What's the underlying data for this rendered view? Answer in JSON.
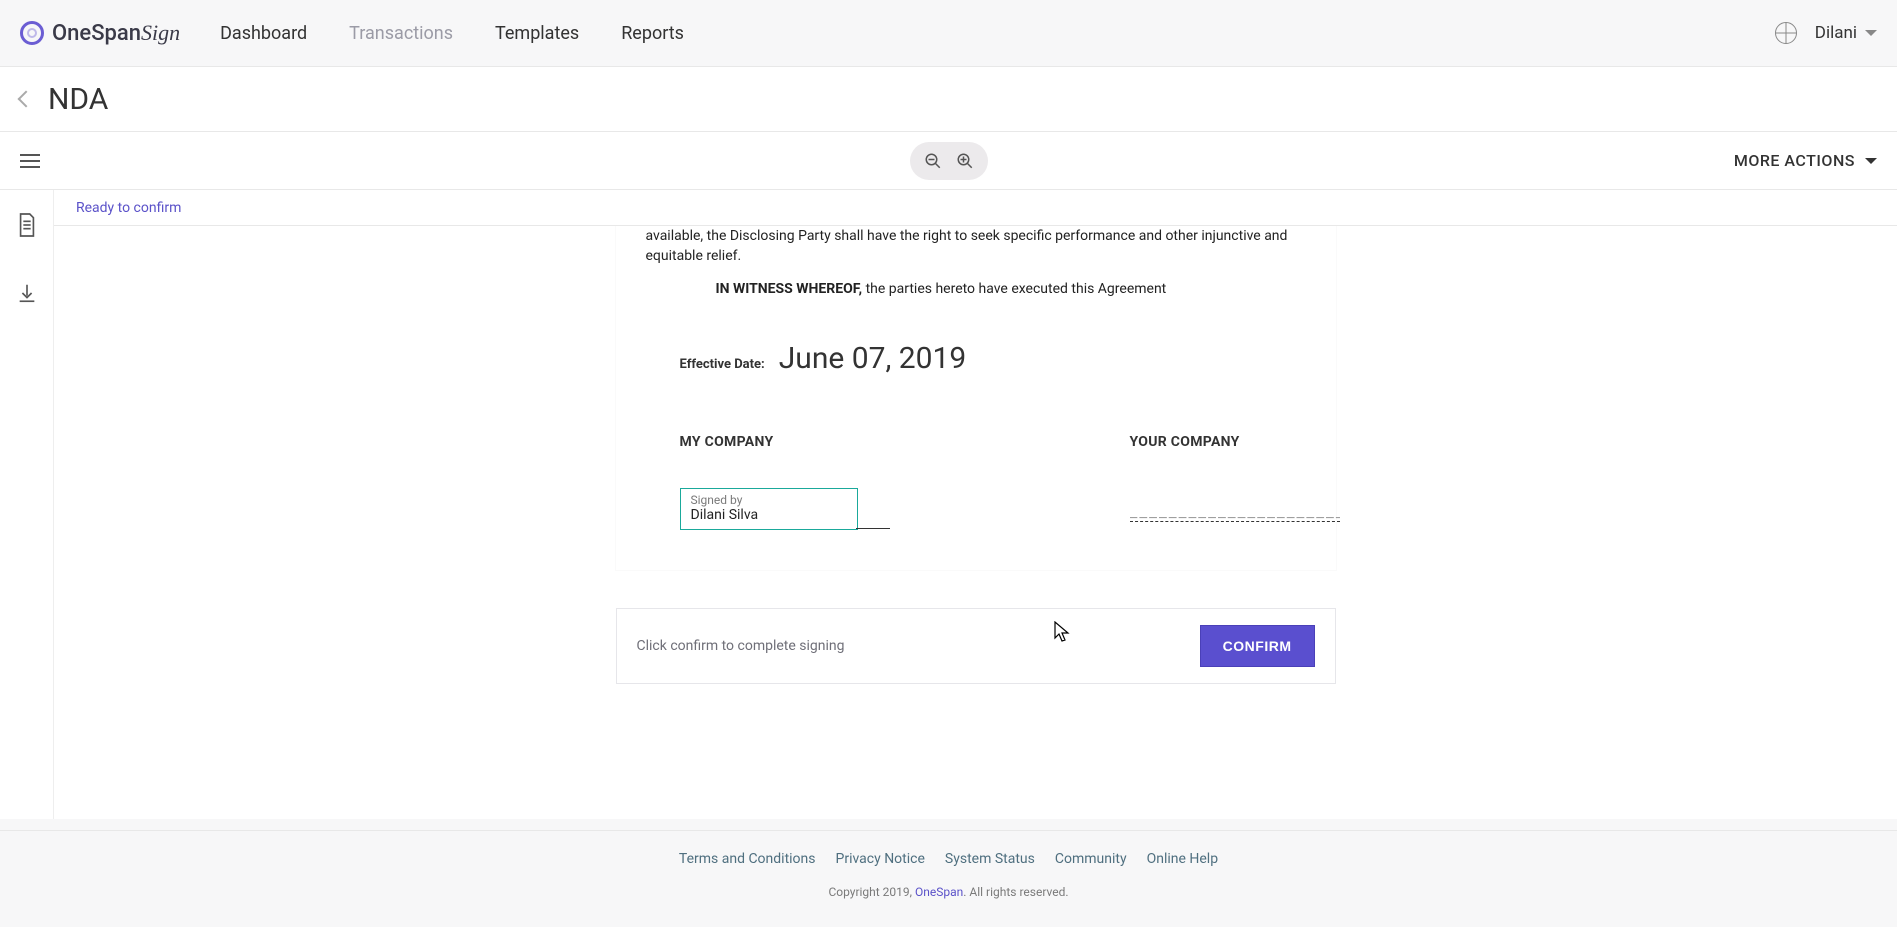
{
  "header": {
    "logo_text": "OneSpan",
    "logo_sign": "Sign",
    "nav": {
      "dashboard": "Dashboard",
      "transactions": "Transactions",
      "templates": "Templates",
      "reports": "Reports"
    },
    "user_name": "Dilani"
  },
  "subheader": {
    "title": "NDA"
  },
  "toolbar": {
    "more_actions": "MORE ACTIONS"
  },
  "status": {
    "text": "Ready to confirm"
  },
  "document": {
    "paragraph_fragment": "available, the Disclosing Party shall have the right to seek specific performance and other injunctive and equitable relief.",
    "witness_bold": "IN WITNESS WHEREOF,",
    "witness_rest": " the parties hereto have executed this Agreement",
    "effective_label": "Effective Date:",
    "effective_date": "June 07, 2019",
    "my_company_label": "MY COMPANY",
    "your_company_label": "YOUR COMPANY",
    "signed_by_label": "Signed by",
    "signer_name": "Dilani Silva",
    "sig_line_placeholder": "_____________________________"
  },
  "confirm": {
    "text": "Click confirm to complete signing",
    "button": "CONFIRM"
  },
  "footer": {
    "terms": "Terms and Conditions",
    "privacy": "Privacy Notice",
    "status": "System Status",
    "community": "Community",
    "help": "Online Help",
    "copyright_pre": "Copyright 2019, ",
    "copyright_brand": "OneSpan",
    "copyright_post": ". All rights reserved."
  }
}
